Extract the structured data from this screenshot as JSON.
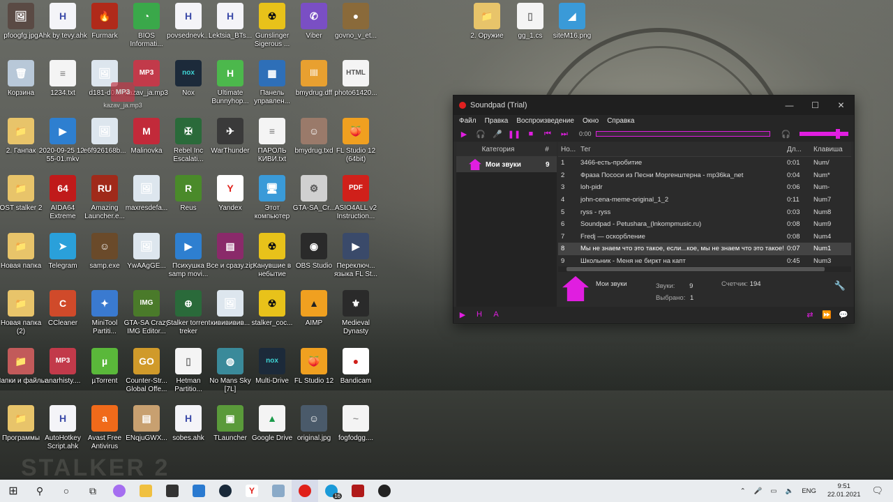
{
  "desktop_icons": [
    {
      "label": "pfoogfg.jpg",
      "color": "#5a4a44",
      "glyph": "🖼"
    },
    {
      "label": "Ahk by tevy.ahk",
      "color": "#f4f4f8",
      "glyph": "H",
      "fg": "#3b4aa8"
    },
    {
      "label": "Furmark",
      "color": "#b02a1a",
      "glyph": "🔥"
    },
    {
      "label": "BIOS Informati...",
      "color": "#3aa84a",
      "glyph": "◔"
    },
    {
      "label": "povsednevk...",
      "color": "#f4f4f8",
      "glyph": "H",
      "fg": "#3b4aa8"
    },
    {
      "label": "Lektsia_BTs...",
      "color": "#f4f4f8",
      "glyph": "H",
      "fg": "#3b4aa8"
    },
    {
      "label": "Gunslinger Sigerous ...",
      "color": "#e8c21a",
      "glyph": "☢",
      "fg": "#111"
    },
    {
      "label": "Viber",
      "color": "#7a4fc4",
      "glyph": "✆"
    },
    {
      "label": "govno_v_et...",
      "color": "#8a6a3a",
      "glyph": "●"
    },
    {
      "label": "Корзина",
      "color": "#b8c8d8",
      "glyph": "🗑"
    },
    {
      "label": "1234.txt",
      "color": "#f4f4f4",
      "glyph": "≡",
      "fg": "#777"
    },
    {
      "label": "d181-d0...",
      "color": "#dde6ee",
      "glyph": "🖼"
    },
    {
      "label": "kazav_ja.mp3",
      "color": "#c23a4a",
      "glyph": "MP3"
    },
    {
      "label": "Nox",
      "color": "#1c2a3a",
      "glyph": "nox",
      "fg": "#3fd6d6"
    },
    {
      "label": "Ultimate Bunnyhop...",
      "color": "#4cb84c",
      "glyph": "H"
    },
    {
      "label": "Панель управлен...",
      "color": "#2e6fb8",
      "glyph": "▦"
    },
    {
      "label": "bmydrug.dff",
      "color": "#e8a030",
      "glyph": "||||"
    },
    {
      "label": "photo61420...",
      "color": "#f4f4f4",
      "glyph": "HTML",
      "fg": "#555"
    },
    {
      "label": "2. Ганпак",
      "color": "#e8c46a",
      "glyph": "📁"
    },
    {
      "label": "2020-09-25 12-55-01.mkv",
      "color": "#2e7fd0",
      "glyph": "▶"
    },
    {
      "label": "e6f926168b...",
      "color": "#dde6ee",
      "glyph": "🖼"
    },
    {
      "label": "Malinovka",
      "color": "#c22a3a",
      "glyph": "M"
    },
    {
      "label": "Rebel Inc Escalati...",
      "color": "#2a6a3a",
      "glyph": "✠"
    },
    {
      "label": "WarThunder",
      "color": "#3a3a3a",
      "glyph": "✈"
    },
    {
      "label": "ПАРОЛЬ КИВИ.txt",
      "color": "#f4f4f4",
      "glyph": "≡",
      "fg": "#777"
    },
    {
      "label": "bmydrug.txd",
      "color": "#9a7a6a",
      "glyph": "☺"
    },
    {
      "label": "FL Studio 12 (64bit)",
      "color": "#f0a020",
      "glyph": "🍑"
    },
    {
      "label": "OST stalker 2",
      "color": "#e8c46a",
      "glyph": "📁"
    },
    {
      "label": "AIDA64 Extreme",
      "color": "#c01a1a",
      "glyph": "64"
    },
    {
      "label": "Amazing Launcher.e...",
      "color": "#a02a1a",
      "glyph": "RU"
    },
    {
      "label": "maxresdefa...",
      "color": "#dde6ee",
      "glyph": "🖼"
    },
    {
      "label": "Reus",
      "color": "#4a8a2a",
      "glyph": "R"
    },
    {
      "label": "Yandex",
      "color": "#ffffff",
      "glyph": "Y",
      "fg": "#e0201a"
    },
    {
      "label": "Этот компьютер",
      "color": "#3a9ad8",
      "glyph": "🖥"
    },
    {
      "label": "GTA-SA_Cr...",
      "color": "#d0d0d0",
      "glyph": "⚙",
      "fg": "#555"
    },
    {
      "label": "ASIO4ALL v2 Instruction...",
      "color": "#d0201a",
      "glyph": "PDF"
    },
    {
      "label": "Новая папка",
      "color": "#e8c46a",
      "glyph": "📁"
    },
    {
      "label": "Telegram",
      "color": "#2aa0da",
      "glyph": "➤"
    },
    {
      "label": "samp.exe",
      "color": "#6a4a2a",
      "glyph": "☺"
    },
    {
      "label": "YwAAgGE...",
      "color": "#dde6ee",
      "glyph": "🖼"
    },
    {
      "label": "Психушка samp movi...",
      "color": "#2e7fd0",
      "glyph": "▶"
    },
    {
      "label": "Все и сразу.zip",
      "color": "#8a2a6a",
      "glyph": "▤"
    },
    {
      "label": "Канувшие в небытие",
      "color": "#e8c21a",
      "glyph": "☢",
      "fg": "#111"
    },
    {
      "label": "OBS Studio",
      "color": "#2a2a2a",
      "glyph": "◉"
    },
    {
      "label": "Переключ... языка FL St...",
      "color": "#3a4a6a",
      "glyph": "▶"
    },
    {
      "label": "Новая папка (2)",
      "color": "#e8c46a",
      "glyph": "📁"
    },
    {
      "label": "CCleaner",
      "color": "#d04a2a",
      "glyph": "C"
    },
    {
      "label": "MiniTool Partiti...",
      "color": "#3a7ad0",
      "glyph": "✦"
    },
    {
      "label": "GTA-SA Crazy IMG Editor...",
      "color": "#4a7a2a",
      "glyph": "IMG"
    },
    {
      "label": "Stalker torrent treker",
      "color": "#2a6a3a",
      "glyph": "⊕"
    },
    {
      "label": "кивививив...",
      "color": "#dde6ee",
      "glyph": "🖼"
    },
    {
      "label": "stalker_coc...",
      "color": "#e8c21a",
      "glyph": "☢",
      "fg": "#111"
    },
    {
      "label": "AIMP",
      "color": "#f0a020",
      "glyph": "▲",
      "fg": "#222"
    },
    {
      "label": "Medieval Dynasty",
      "color": "#2a2a2a",
      "glyph": "⚜"
    },
    {
      "label": "Папки и файлы",
      "color": "#c25a5a",
      "glyph": "📁"
    },
    {
      "label": "anarhisty....",
      "color": "#c23a4a",
      "glyph": "MP3"
    },
    {
      "label": "µTorrent",
      "color": "#5ab83a",
      "glyph": "µ"
    },
    {
      "label": "Counter-Str... Global Offe...",
      "color": "#d09a2a",
      "glyph": "GO"
    },
    {
      "label": "Hetman Partitio...",
      "color": "#f4f4f4",
      "glyph": "▯",
      "fg": "#777"
    },
    {
      "label": "No Mans Sky [7L]",
      "color": "#3a8a9a",
      "glyph": "◍"
    },
    {
      "label": "Multi-Drive",
      "color": "#1c2a3a",
      "glyph": "nox",
      "fg": "#3fd6d6"
    },
    {
      "label": "FL Studio 12",
      "color": "#f0a020",
      "glyph": "🍑"
    },
    {
      "label": "Bandicam",
      "color": "#ffffff",
      "glyph": "●",
      "fg": "#d0201a"
    },
    {
      "label": "Программы",
      "color": "#e8c46a",
      "glyph": "📁"
    },
    {
      "label": "AutoHotkey Script.ahk",
      "color": "#f4f4f8",
      "glyph": "H",
      "fg": "#3b4aa8"
    },
    {
      "label": "Avast Free Antivirus",
      "color": "#f06a1a",
      "glyph": "a"
    },
    {
      "label": "ENqjuGWX...",
      "color": "#c8a070",
      "glyph": "▤"
    },
    {
      "label": "sobes.ahk",
      "color": "#f4f4f8",
      "glyph": "H",
      "fg": "#3b4aa8"
    },
    {
      "label": "TLauncher",
      "color": "#5a9a3a",
      "glyph": "▣"
    },
    {
      "label": "Google Drive",
      "color": "#f4f4f4",
      "glyph": "▲",
      "fg": "#1a9a4a"
    },
    {
      "label": "original.jpg",
      "color": "#4a5a6a",
      "glyph": "☺"
    },
    {
      "label": "fogfodgg....",
      "color": "#f4f4f4",
      "glyph": "~",
      "fg": "#999"
    },
    {
      "label": "2. Оружие",
      "color": "#e8c46a",
      "glyph": "📁"
    },
    {
      "label": "gg_1.cs",
      "color": "#f4f4f4",
      "glyph": "▯",
      "fg": "#777"
    },
    {
      "label": "siteM16.png",
      "color": "#3a9ad8",
      "glyph": "◢"
    }
  ],
  "drag_ghost": {
    "badge": "MP3",
    "label": "kazav_ja.mp3"
  },
  "wallpaper_text": "STALKER 2",
  "soundpad": {
    "title": "Soundpad (Trial)",
    "window_buttons": {
      "minimize": "—",
      "maximize": "☐",
      "close": "✕"
    },
    "menu": [
      "Файл",
      "Правка",
      "Воспроизведение",
      "Окно",
      "Справка"
    ],
    "time": "0:00",
    "accent": "#e01ee0",
    "cat_headers": {
      "category": "Категория",
      "count": "#"
    },
    "categories": [
      {
        "name": "Мои звуки",
        "count": "9"
      }
    ],
    "list_headers": {
      "no": "Но...",
      "tag": "Тег",
      "dur": "Дл...",
      "key": "Клавиша"
    },
    "sounds": [
      {
        "no": "1",
        "tag": "3466-есть-пробитие",
        "dur": "0:01",
        "key": "Num/"
      },
      {
        "no": "2",
        "tag": "Фраза Пососи из Песни Моргенштерна - mp36ka_net",
        "dur": "0:04",
        "key": "Num*"
      },
      {
        "no": "3",
        "tag": "loh-pidr",
        "dur": "0:06",
        "key": "Num-"
      },
      {
        "no": "4",
        "tag": "john-cena-meme-original_1_2",
        "dur": "0:11",
        "key": "Num7"
      },
      {
        "no": "5",
        "tag": "ryss - ryss",
        "dur": "0:03",
        "key": "Num8"
      },
      {
        "no": "6",
        "tag": "Soundpad - Petushara_(lnkompmusic.ru)",
        "dur": "0:08",
        "key": "Num9"
      },
      {
        "no": "7",
        "tag": "Fredj — оскорбление",
        "dur": "0:08",
        "key": "Num4"
      },
      {
        "no": "8",
        "tag": "Мы не знаем что это такое, если...кое, мы не знаем что это такое!",
        "dur": "0:07",
        "key": "Num1"
      },
      {
        "no": "9",
        "tag": "Школьник - Меня не биркт на капт",
        "dur": "0:45",
        "key": "Num3"
      }
    ],
    "info": {
      "category": "Мои звуки",
      "sounds_label": "Звуки:",
      "sounds_value": "9",
      "selected_label": "Выбрано:",
      "selected_value": "1",
      "counter_label": "Счетчик:",
      "counter_value": "194"
    }
  },
  "taskbar": {
    "lang": "ENG",
    "time": "9:51",
    "date": "22.01.2021",
    "skype_badge": "16"
  }
}
